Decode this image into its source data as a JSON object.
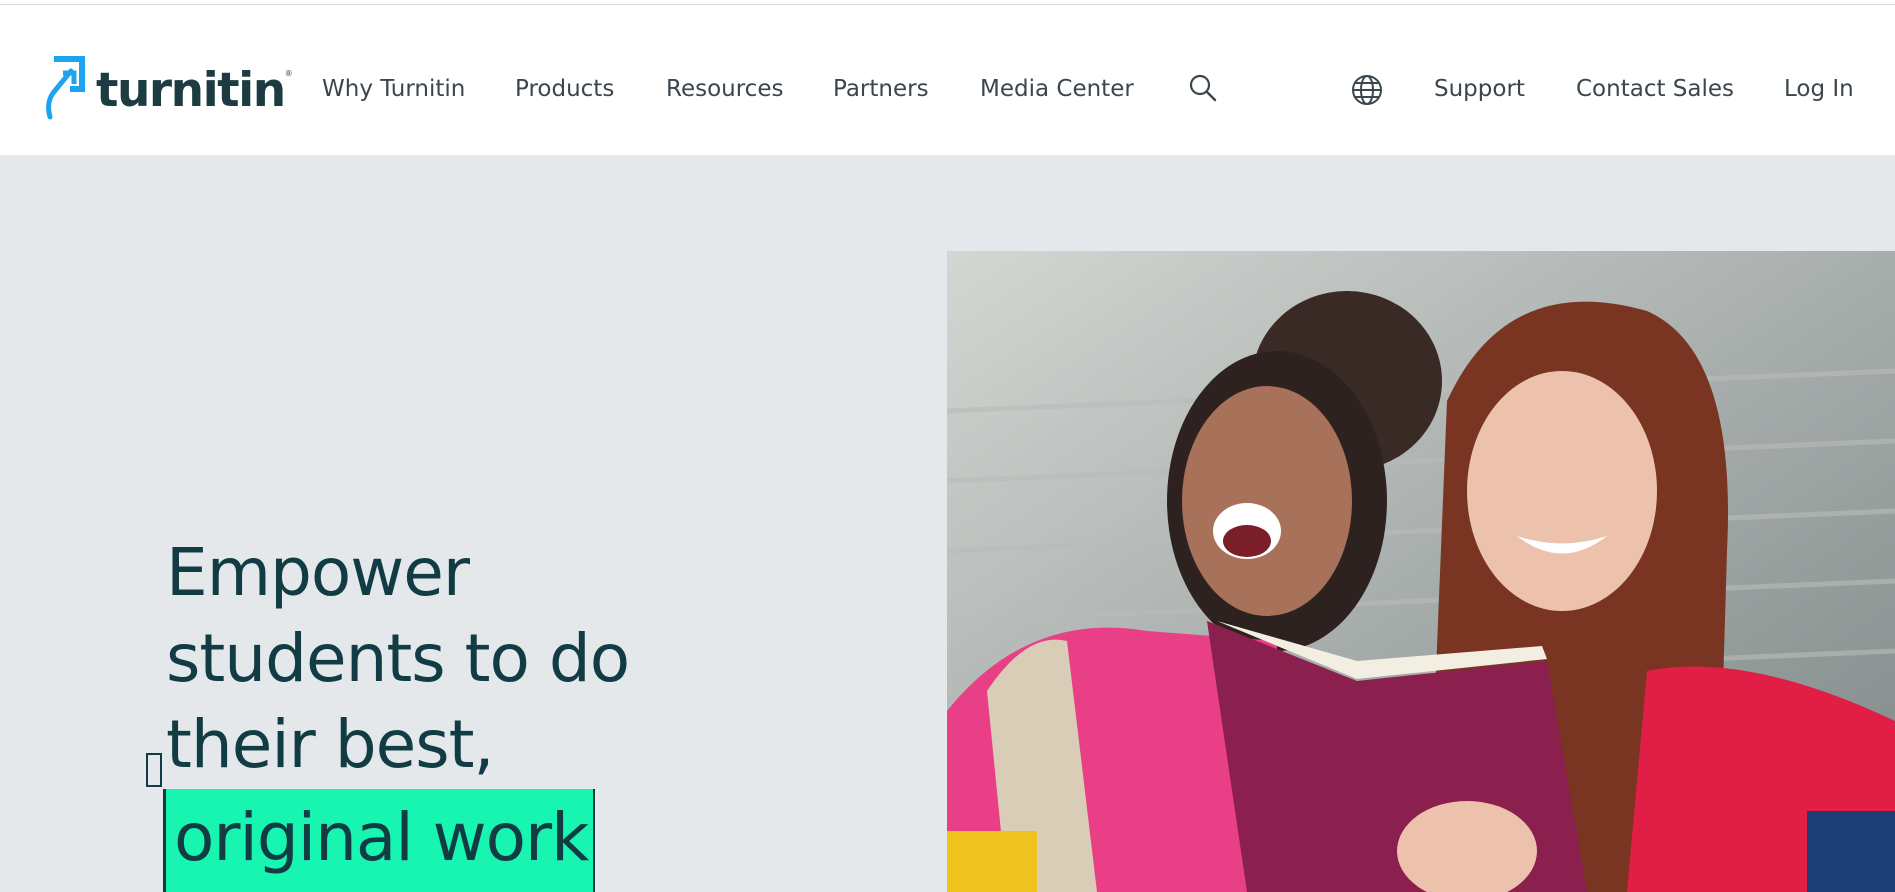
{
  "brand": {
    "name": "turnitin",
    "registered_mark": "®",
    "colors": {
      "primary_text": "#1c3c42",
      "logo_blue": "#1ea3f0",
      "highlight": "#18f5b0",
      "hero_bg": "#e4e8ea"
    }
  },
  "nav": {
    "primary": [
      {
        "label": "Why Turnitin"
      },
      {
        "label": "Products"
      },
      {
        "label": "Resources"
      },
      {
        "label": "Partners"
      },
      {
        "label": "Media Center"
      }
    ],
    "search_icon": "search-icon",
    "language_icon": "globe-icon",
    "secondary": [
      {
        "label": "Support"
      },
      {
        "label": "Contact Sales"
      },
      {
        "label": "Log In"
      }
    ]
  },
  "hero": {
    "headline_lines": [
      "Empower",
      "students to do",
      "their best,"
    ],
    "highlight_text": "original work"
  }
}
